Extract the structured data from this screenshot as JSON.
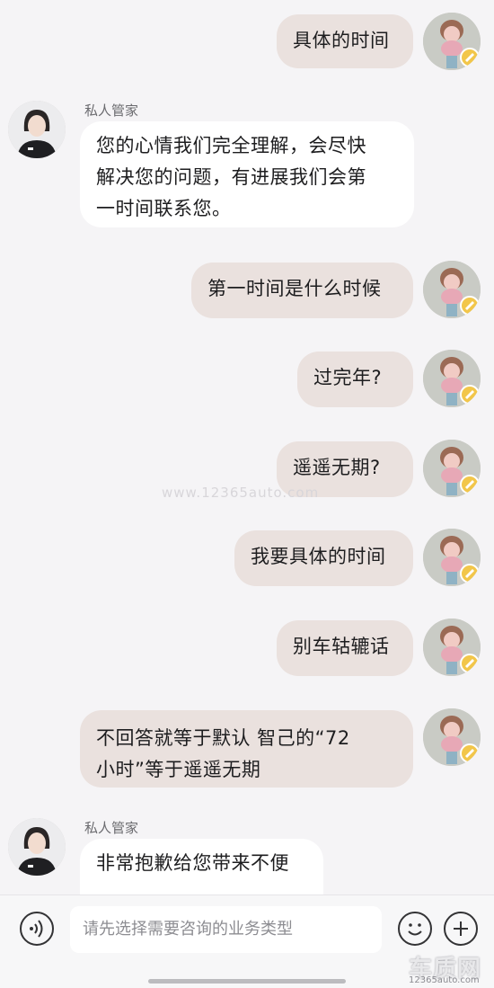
{
  "agent": {
    "name": "私人管家"
  },
  "messages": [
    {
      "side": "out",
      "text": "具体的时间"
    },
    {
      "side": "in",
      "lines": [
        "您的心情我们完全理解，会尽快",
        "解决您的问题，有进展我们会第",
        "一时间联系您。"
      ]
    },
    {
      "side": "out",
      "text": "第一时间是什么时候"
    },
    {
      "side": "out",
      "text": "过完年?"
    },
    {
      "side": "out",
      "text": "遥遥无期?"
    },
    {
      "side": "out",
      "text": "我要具体的时间"
    },
    {
      "side": "out",
      "text": "别车轱辘话"
    },
    {
      "side": "out",
      "lines": [
        "不回答就等于默认 智己的“72",
        "小时”等于遥遥无期"
      ]
    },
    {
      "side": "in",
      "text": "非常抱歉给您带来不便"
    }
  ],
  "watermark": "www.12365auto.com",
  "input": {
    "placeholder": "请先选择需要咨询的业务类型"
  },
  "logo": {
    "main": "车质网",
    "sub": "12365auto.com"
  },
  "colors": {
    "outgoing_bubble": "#eae1de",
    "incoming_bubble": "#ffffff",
    "background": "#f5f4f6"
  },
  "icons": {
    "voice": "voice-icon",
    "emoji": "emoji-icon",
    "plus": "plus-icon"
  }
}
